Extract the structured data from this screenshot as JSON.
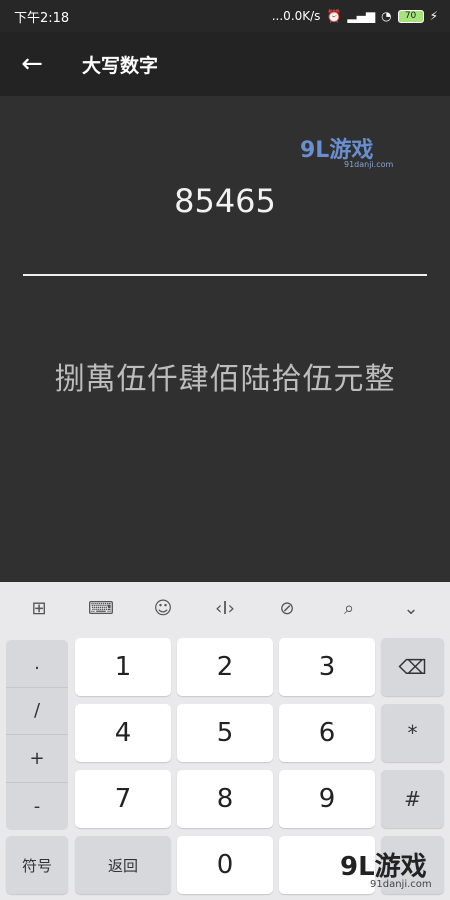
{
  "status": {
    "time": "下午2:18",
    "speed": "...0.0K/s",
    "battery": "70"
  },
  "appbar": {
    "back_icon": "←",
    "title": "大写数字"
  },
  "main": {
    "input_value": "85465",
    "result": "捌萬伍仟肆佰陆拾伍元整"
  },
  "watermark": {
    "top_logo": "9L游戏",
    "top_sub": "91danji.com",
    "bottom_logo": "9L游戏",
    "bottom_sub": "91danji.com"
  },
  "toolbar": {
    "icons": [
      "grid-icon",
      "keyboard-icon",
      "emoji-icon",
      "cursor-icon",
      "link-icon",
      "search-icon",
      "collapse-icon"
    ],
    "glyphs": [
      "⊞",
      "⌨",
      "☺",
      "‹I›",
      "⊘",
      "⌕",
      "⌄"
    ]
  },
  "keys": {
    "symbols": [
      ".",
      "/",
      "+",
      "-"
    ],
    "digits": [
      "1",
      "2",
      "3",
      "4",
      "5",
      "6",
      "7",
      "8",
      "9",
      "0"
    ],
    "backspace": "⌫",
    "star": "*",
    "hash": "#",
    "fuhao": "符号",
    "fanhui": "返回"
  }
}
